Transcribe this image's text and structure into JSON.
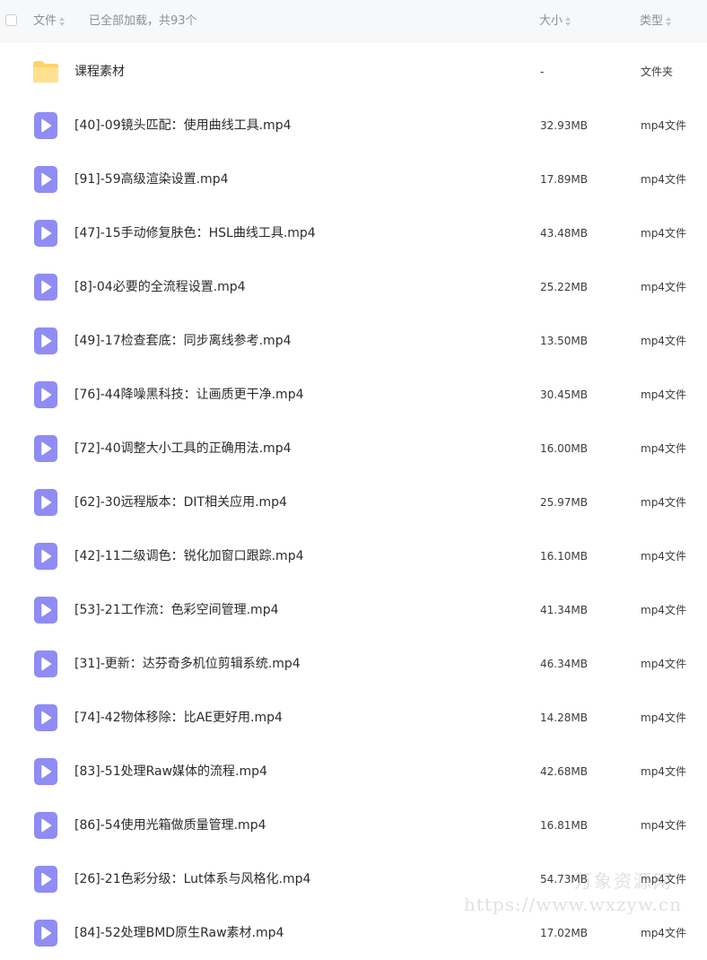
{
  "header": {
    "name_label": "文件",
    "loaded_text": "已全部加载，共93个",
    "size_label": "大小",
    "type_label": "类型"
  },
  "colors": {
    "folder": "#fdd46a",
    "video_icon": "#8f8cf5",
    "header_bg": "#f7f8fa"
  },
  "rows": [
    {
      "icon": "folder-icon",
      "name": "课程素材",
      "size": "-",
      "type": "文件夹"
    },
    {
      "icon": "video-file-icon",
      "name": "[40]-09镜头匹配：使用曲线工具.mp4",
      "size": "32.93MB",
      "type": "mp4文件"
    },
    {
      "icon": "video-file-icon",
      "name": "[91]-59高级渲染设置.mp4",
      "size": "17.89MB",
      "type": "mp4文件"
    },
    {
      "icon": "video-file-icon",
      "name": "[47]-15手动修复肤色：HSL曲线工具.mp4",
      "size": "43.48MB",
      "type": "mp4文件"
    },
    {
      "icon": "video-file-icon",
      "name": "[8]-04必要的全流程设置.mp4",
      "size": "25.22MB",
      "type": "mp4文件"
    },
    {
      "icon": "video-file-icon",
      "name": "[49]-17检查套底：同步离线参考.mp4",
      "size": "13.50MB",
      "type": "mp4文件"
    },
    {
      "icon": "video-file-icon",
      "name": "[76]-44降噪黑科技：让画质更干净.mp4",
      "size": "30.45MB",
      "type": "mp4文件"
    },
    {
      "icon": "video-file-icon",
      "name": "[72]-40调整大小工具的正确用法.mp4",
      "size": "16.00MB",
      "type": "mp4文件"
    },
    {
      "icon": "video-file-icon",
      "name": "[62]-30远程版本：DIT相关应用.mp4",
      "size": "25.97MB",
      "type": "mp4文件"
    },
    {
      "icon": "video-file-icon",
      "name": "[42]-11二级调色：锐化加窗口跟踪.mp4",
      "size": "16.10MB",
      "type": "mp4文件"
    },
    {
      "icon": "video-file-icon",
      "name": "[53]-21工作流：色彩空间管理.mp4",
      "size": "41.34MB",
      "type": "mp4文件"
    },
    {
      "icon": "video-file-icon",
      "name": "[31]-更新：达芬奇多机位剪辑系统.mp4",
      "size": "46.34MB",
      "type": "mp4文件"
    },
    {
      "icon": "video-file-icon",
      "name": "[74]-42物体移除：比AE更好用.mp4",
      "size": "14.28MB",
      "type": "mp4文件"
    },
    {
      "icon": "video-file-icon",
      "name": "[83]-51处理Raw媒体的流程.mp4",
      "size": "42.68MB",
      "type": "mp4文件"
    },
    {
      "icon": "video-file-icon",
      "name": "[86]-54使用光箱做质量管理.mp4",
      "size": "16.81MB",
      "type": "mp4文件"
    },
    {
      "icon": "video-file-icon",
      "name": "[26]-21色彩分级：Lut体系与风格化.mp4",
      "size": "54.73MB",
      "type": "mp4文件"
    },
    {
      "icon": "video-file-icon",
      "name": "[84]-52处理BMD原生Raw素材.mp4",
      "size": "17.02MB",
      "type": "mp4文件"
    }
  ],
  "watermark": {
    "line1": "万象资源网",
    "line2": "https://www.wxzyw.cn"
  }
}
